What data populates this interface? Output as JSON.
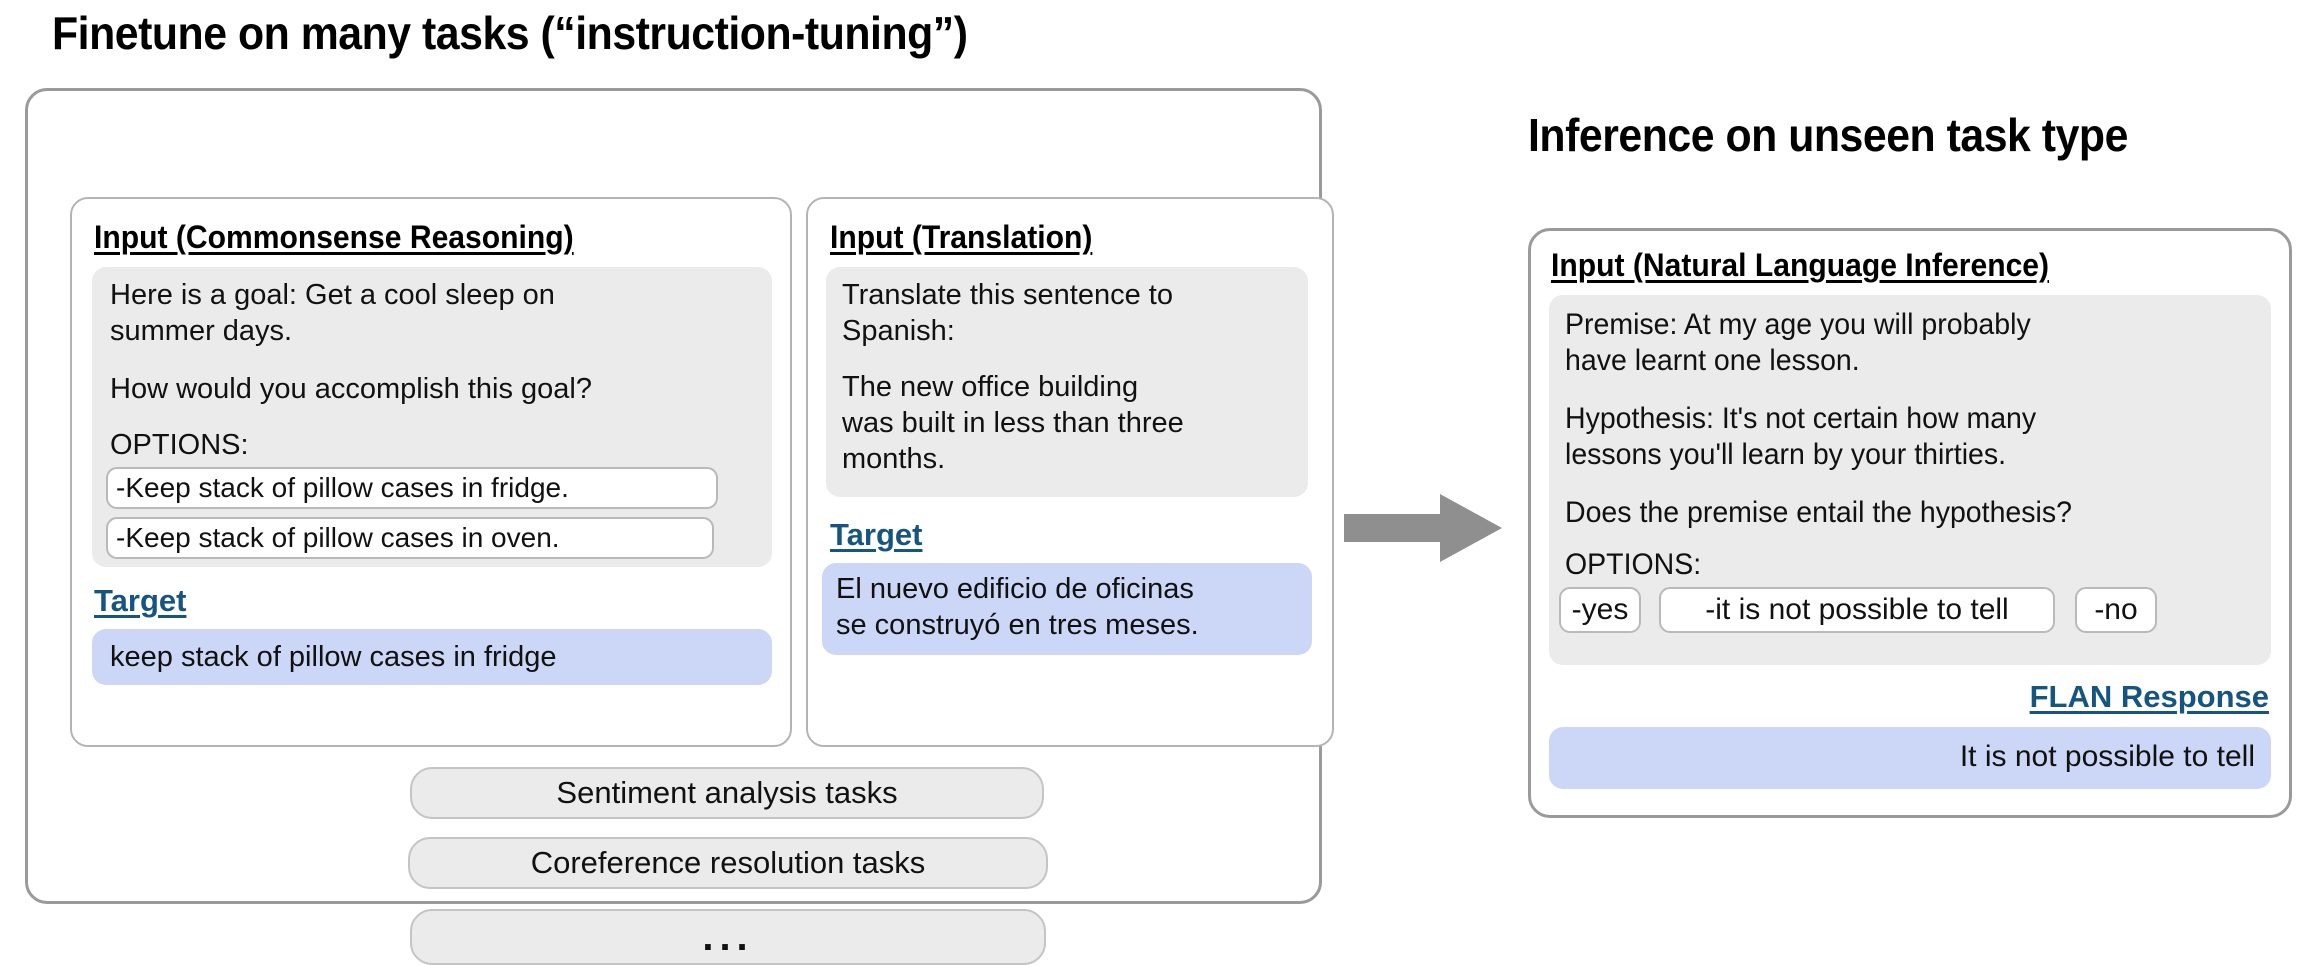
{
  "headings": {
    "finetune_title": "Finetune on many tasks (“instruction-tuning”)",
    "inference_title": "Inference on unseen task type"
  },
  "finetune": {
    "panels": [
      {
        "heading": "Input (Commonsense Reasoning)",
        "input_lines": [
          "Here is a goal: Get a cool sleep on",
          "summer days.",
          "How would you accomplish this goal?",
          "OPTIONS:"
        ],
        "options": [
          "-Keep stack of pillow cases in fridge.",
          "-Keep stack of pillow cases in oven."
        ],
        "target_label": "Target",
        "target_text": "keep stack of pillow cases in fridge"
      },
      {
        "heading": "Input (Translation)",
        "input_lines": [
          "Translate this sentence to",
          "Spanish:",
          "The new office building",
          "was built in less than three",
          "months."
        ],
        "target_label": "Target",
        "target_lines": [
          "El nuevo edificio de oficinas",
          "se construyó en tres meses."
        ]
      }
    ],
    "more_tasks": [
      "Sentiment analysis tasks",
      "Coreference resolution tasks",
      "..."
    ]
  },
  "inference": {
    "heading": "Input (Natural Language Inference)",
    "input_lines": [
      "Premise: At my age you will probably",
      "have learnt one lesson.",
      "Hypothesis: It's not certain how many",
      "lessons you'll learn by your thirties.",
      "Does the premise entail the hypothesis?",
      "OPTIONS:"
    ],
    "options": [
      "-yes",
      "-it is not possible to tell",
      "-no"
    ],
    "response_label": "FLAN Response",
    "response_text": "It is not possible to tell"
  },
  "icons": {
    "flow_arrow": "right-arrow-icon"
  },
  "colors": {
    "accent_blue_text": "#16557f",
    "target_bubble": "#ccd7f7",
    "input_bubble": "#ebebeb",
    "arrow": "#8f8f8f",
    "outer_border": "#9a9a9a"
  }
}
